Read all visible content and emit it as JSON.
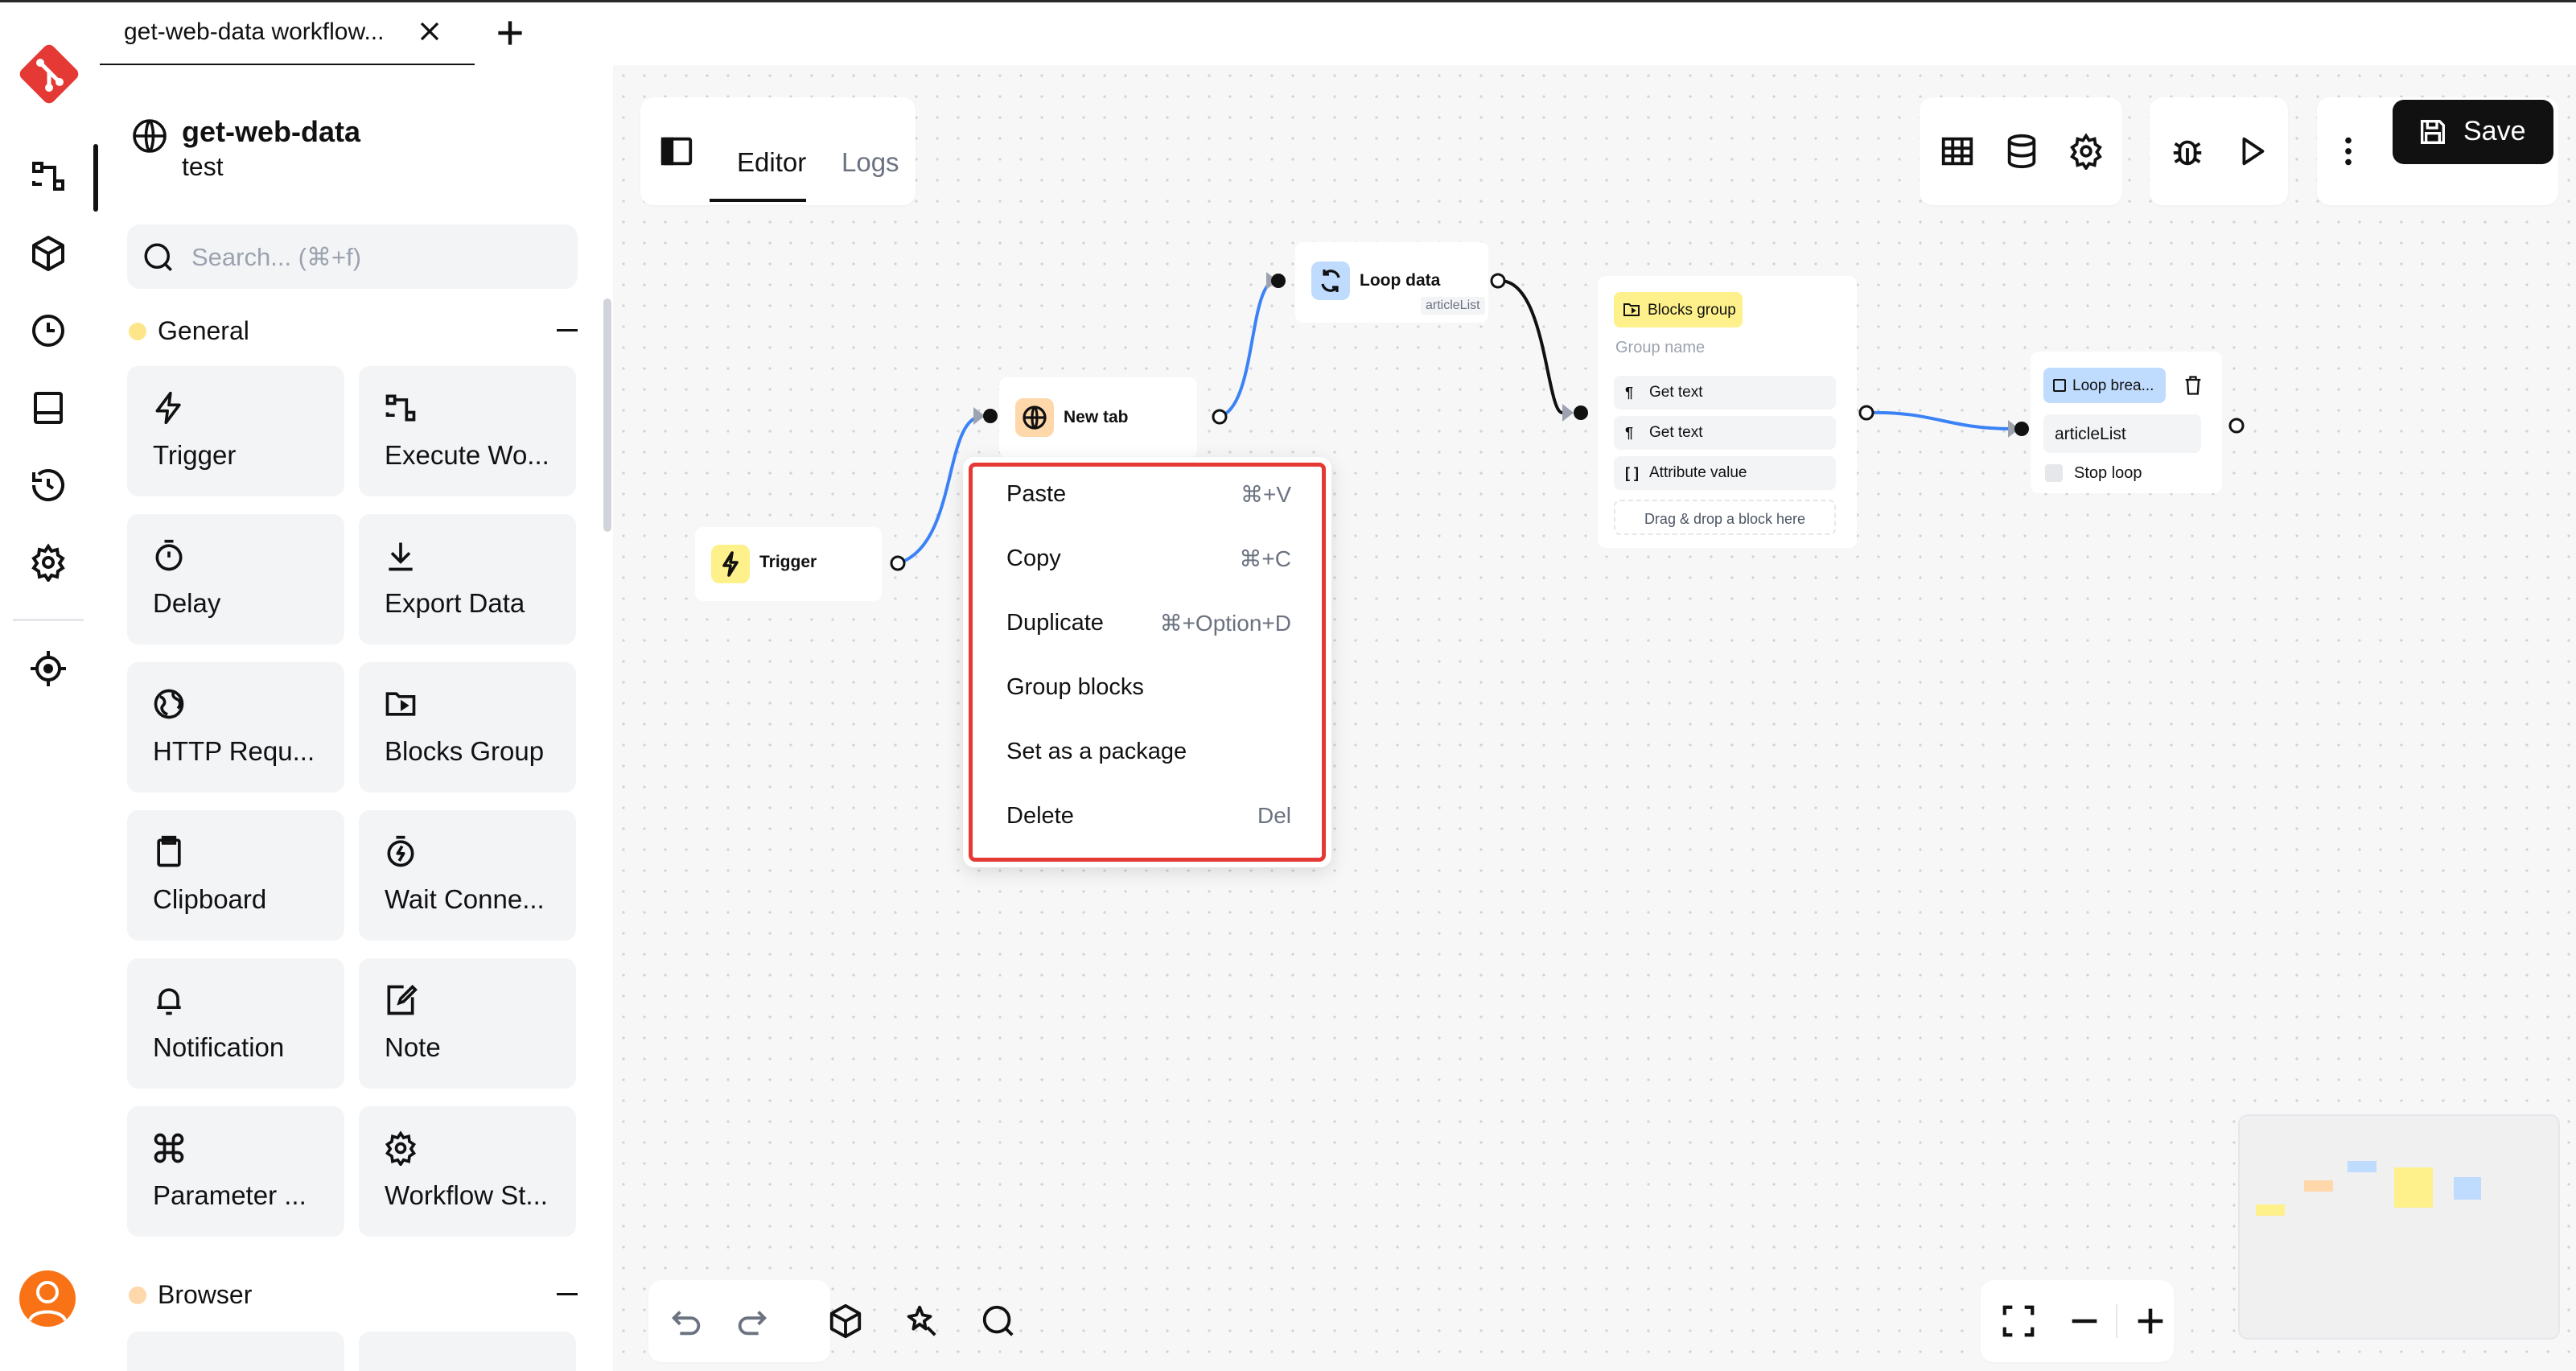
{
  "tab": {
    "title": "get-web-data workflow..."
  },
  "workflow": {
    "name": "get-web-data",
    "description": "test"
  },
  "search": {
    "placeholder": "Search... (⌘+f)"
  },
  "categories": [
    {
      "label": "General",
      "color": "#fde68a"
    },
    {
      "label": "Browser",
      "color": "#fed7aa"
    }
  ],
  "blocks": [
    {
      "label": "Trigger",
      "icon": "lightning-icon"
    },
    {
      "label": "Execute Wo...",
      "icon": "execute-workflow-icon"
    },
    {
      "label": "Delay",
      "icon": "timer-icon"
    },
    {
      "label": "Export Data",
      "icon": "download-icon"
    },
    {
      "label": "HTTP Requ...",
      "icon": "globe-icon"
    },
    {
      "label": "Blocks Group",
      "icon": "folder-icon"
    },
    {
      "label": "Clipboard",
      "icon": "clipboard-icon"
    },
    {
      "label": "Wait Conne...",
      "icon": "timer-flash-icon"
    },
    {
      "label": "Notification",
      "icon": "bell-icon"
    },
    {
      "label": "Note",
      "icon": "note-icon"
    },
    {
      "label": "Parameter ...",
      "icon": "command-icon"
    },
    {
      "label": "Workflow St...",
      "icon": "gear-icon"
    }
  ],
  "editor": {
    "tab_editor": "Editor",
    "tab_logs": "Logs",
    "save_label": "Save"
  },
  "nodes": {
    "trigger": {
      "label": "Trigger",
      "color": "#fef08a"
    },
    "new_tab": {
      "label": "New tab",
      "color": "#fed7aa"
    },
    "loop_data": {
      "label": "Loop data",
      "sublabel": "articleList",
      "color": "#bfdbfe"
    },
    "blocks_group": {
      "label": "Blocks group",
      "placeholder": "Group name",
      "rows": [
        "Get text",
        "Get text",
        "Attribute value"
      ],
      "drop_hint": "Drag & drop a block here",
      "color": "#fef08a"
    },
    "loop_breakpoint": {
      "label": "Loop brea...",
      "value": "articleList",
      "stop_label": "Stop loop",
      "color": "#bfdbfe"
    }
  },
  "context_menu": {
    "items": [
      {
        "label": "Paste",
        "shortcut": "⌘+V"
      },
      {
        "label": "Copy",
        "shortcut": "⌘+C"
      },
      {
        "label": "Duplicate",
        "shortcut": "⌘+Option+D"
      },
      {
        "label": "Group blocks",
        "shortcut": ""
      },
      {
        "label": "Set as a package",
        "shortcut": ""
      },
      {
        "label": "Delete",
        "shortcut": "Del"
      }
    ],
    "highlight_color": "#e53935"
  },
  "colors": {
    "brand": "#e53935",
    "edge_active": "#3b82f6",
    "edge_default": "#111111"
  }
}
